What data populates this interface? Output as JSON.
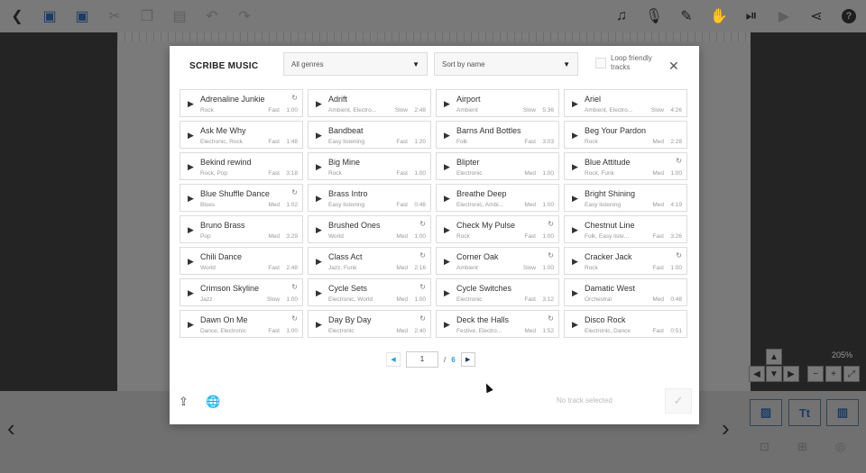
{
  "toolbar": {
    "left_icons": [
      "back-icon",
      "save-icon",
      "save-as-icon",
      "cut-icon",
      "copy-icon",
      "paste-icon",
      "undo-icon",
      "redo-icon"
    ],
    "right_icons": [
      "music-note-icon",
      "microphone-icon",
      "brush-icon",
      "hand-icon",
      "play-from-icon",
      "play-icon",
      "share-icon",
      "help-icon"
    ]
  },
  "canvas": {
    "zoom_level": "205%"
  },
  "modal": {
    "title": "SCRIBE MUSIC",
    "genre_select": {
      "selected": "All genres"
    },
    "sort_select": {
      "selected": "Sort by name"
    },
    "loop_friendly_label": "Loop friendly tracks",
    "pagination": {
      "current_page": "1",
      "separator": "/",
      "total_pages": "6"
    },
    "status_text": "No track selected",
    "tracks": [
      {
        "name": "Adrenaline Junkie",
        "genre": "Rock",
        "speed": "Fast",
        "duration": "1:00",
        "loop": true
      },
      {
        "name": "Adrift",
        "genre": "Ambient, Electro...",
        "speed": "Slow",
        "duration": "2:48",
        "loop": false
      },
      {
        "name": "Airport",
        "genre": "Ambient",
        "speed": "Slow",
        "duration": "5:36",
        "loop": false
      },
      {
        "name": "Ariel",
        "genre": "Ambient, Electro...",
        "speed": "Slow",
        "duration": "4:26",
        "loop": false
      },
      {
        "name": "Ask Me Why",
        "genre": "Electronic, Rock",
        "speed": "Fast",
        "duration": "1:48",
        "loop": false
      },
      {
        "name": "Bandbeat",
        "genre": "Easy listening",
        "speed": "Fast",
        "duration": "1:20",
        "loop": false
      },
      {
        "name": "Barns And Bottles",
        "genre": "Folk",
        "speed": "Fast",
        "duration": "3:03",
        "loop": false
      },
      {
        "name": "Beg Your Pardon",
        "genre": "Rock",
        "speed": "Med",
        "duration": "2:28",
        "loop": false
      },
      {
        "name": "Bekind rewind",
        "genre": "Rock, Pop",
        "speed": "Fast",
        "duration": "3:18",
        "loop": false
      },
      {
        "name": "Big Mine",
        "genre": "Rock",
        "speed": "Fast",
        "duration": "1:00",
        "loop": false
      },
      {
        "name": "Blipter",
        "genre": "Electronic",
        "speed": "Med",
        "duration": "1:00",
        "loop": false
      },
      {
        "name": "Blue Attitude",
        "genre": "Rock, Funk",
        "speed": "Med",
        "duration": "1:00",
        "loop": true
      },
      {
        "name": "Blue Shuffle Dance",
        "genre": "Blues",
        "speed": "Med",
        "duration": "1:02",
        "loop": true
      },
      {
        "name": "Brass Intro",
        "genre": "Easy listening",
        "speed": "Fast",
        "duration": "0:46",
        "loop": false
      },
      {
        "name": "Breathe Deep",
        "genre": "Electronic, Ambi...",
        "speed": "Med",
        "duration": "1:00",
        "loop": false
      },
      {
        "name": "Bright Shining",
        "genre": "Easy listening",
        "speed": "Med",
        "duration": "4:19",
        "loop": false
      },
      {
        "name": "Bruno Brass",
        "genre": "Pop",
        "speed": "Med",
        "duration": "3:29",
        "loop": false
      },
      {
        "name": "Brushed Ones",
        "genre": "World",
        "speed": "Med",
        "duration": "1:00",
        "loop": true
      },
      {
        "name": "Check My Pulse",
        "genre": "Rock",
        "speed": "Fast",
        "duration": "1:00",
        "loop": true
      },
      {
        "name": "Chestnut Line",
        "genre": "Folk, Easy liste...",
        "speed": "Fast",
        "duration": "3:26",
        "loop": false
      },
      {
        "name": "Chili Dance",
        "genre": "World",
        "speed": "Fast",
        "duration": "2:48",
        "loop": false
      },
      {
        "name": "Class Act",
        "genre": "Jazz, Funk",
        "speed": "Med",
        "duration": "2:16",
        "loop": true
      },
      {
        "name": "Corner Oak",
        "genre": "Ambient",
        "speed": "Slow",
        "duration": "1:00",
        "loop": true
      },
      {
        "name": "Cracker Jack",
        "genre": "Rock",
        "speed": "Fast",
        "duration": "1:00",
        "loop": true
      },
      {
        "name": "Crimson Skyline",
        "genre": "Jazz",
        "speed": "Slow",
        "duration": "1:00",
        "loop": true
      },
      {
        "name": "Cycle Sets",
        "genre": "Electronic, World",
        "speed": "Med",
        "duration": "1:00",
        "loop": true
      },
      {
        "name": "Cycle Switches",
        "genre": "Electronic",
        "speed": "Fast",
        "duration": "3:12",
        "loop": false
      },
      {
        "name": "Damatic West",
        "genre": "Orchestral",
        "speed": "Med",
        "duration": "0:48",
        "loop": false
      },
      {
        "name": "Dawn On Me",
        "genre": "Dance, Electronic",
        "speed": "Fast",
        "duration": "1:00",
        "loop": true
      },
      {
        "name": "Day By Day",
        "genre": "Electronic",
        "speed": "Med",
        "duration": "2:40",
        "loop": true
      },
      {
        "name": "Deck the Halls",
        "genre": "Festive, Electro...",
        "speed": "Med",
        "duration": "1:52",
        "loop": true
      },
      {
        "name": "Disco Rock",
        "genre": "Electronic, Dance",
        "speed": "Fast",
        "duration": "0:51",
        "loop": false
      }
    ]
  },
  "bottom": {
    "tool_labels": [
      "",
      "Tt",
      ""
    ]
  }
}
